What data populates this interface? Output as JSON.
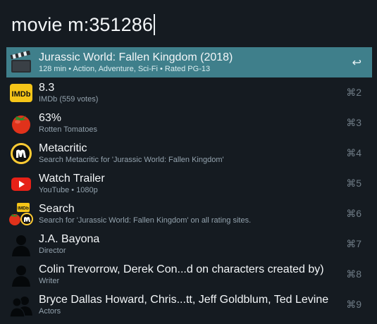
{
  "query": {
    "text": "movie m:351286"
  },
  "results": [
    {
      "title": "Jurassic World: Fallen Kingdom (2018)",
      "subtitle": "128 min • Action, Adventure, Sci-Fi • Rated PG-13",
      "shortcut": "↩",
      "icon": "clapperboard-icon",
      "selected": true
    },
    {
      "title": "8.3",
      "subtitle": "IMDb (559 votes)",
      "shortcut": "⌘2",
      "icon": "imdb-logo-icon"
    },
    {
      "title": "63%",
      "subtitle": "Rotten Tomatoes",
      "shortcut": "⌘3",
      "icon": "tomato-icon"
    },
    {
      "title": "Metacritic",
      "subtitle": "Search Metacritic for 'Jurassic World: Fallen Kingdom'",
      "shortcut": "⌘4",
      "icon": "metacritic-logo-icon"
    },
    {
      "title": "Watch Trailer",
      "subtitle": "YouTube • 1080p",
      "shortcut": "⌘5",
      "icon": "youtube-play-icon"
    },
    {
      "title": "Search",
      "subtitle": "Search for 'Jurassic World: Fallen Kingdom' on all rating sites.",
      "shortcut": "⌘6",
      "icon": "rating-sites-icon"
    },
    {
      "title": "J.A. Bayona",
      "subtitle": "Director",
      "shortcut": "⌘7",
      "icon": "person-icon"
    },
    {
      "title": "Colin Trevorrow, Derek Con...d on characters created by)",
      "subtitle": "Writer",
      "shortcut": "⌘8",
      "icon": "person-icon"
    },
    {
      "title": "Bryce Dallas Howard, Chris...tt, Jeff Goldblum, Ted Levine",
      "subtitle": "Actors",
      "shortcut": "⌘9",
      "icon": "people-icon"
    }
  ],
  "icon_labels": {
    "imdb": "IMDb",
    "imdb_small": "IMDb"
  },
  "colors": {
    "selected": "#3f7f8b",
    "background": "#151b21",
    "imdb": "#f5c518",
    "tomato": "#e0321b",
    "youtube": "#e62117",
    "metacritic": "#ffcc34"
  }
}
